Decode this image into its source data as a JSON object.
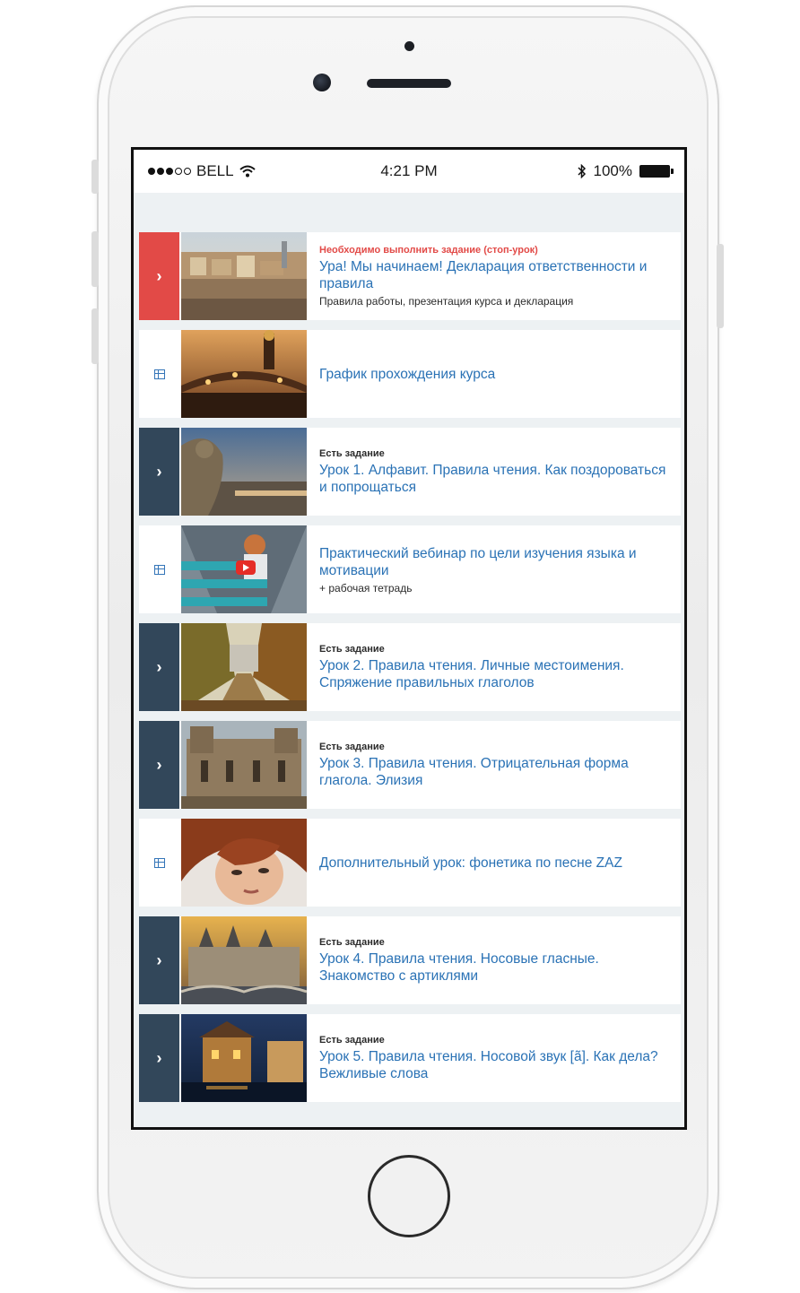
{
  "status_bar": {
    "carrier": "BELL",
    "time": "4:21 PM",
    "battery": "100%",
    "signal_bars": 3,
    "signal_total": 5
  },
  "items": [
    {
      "type": "stop",
      "icon": "chevron-right",
      "tag": "Необходимо выполнить задание (стоп-урок)",
      "title": "Ура! Мы начинаем! Декларация ответственности и правила",
      "subtitle": "Правила работы, презентация курса и декларация",
      "thumb": "paris-rooftops"
    },
    {
      "type": "doc",
      "icon": "table-icon",
      "tag": "",
      "title": "График прохождения курса",
      "subtitle": "",
      "thumb": "bridge-sunset"
    },
    {
      "type": "lesson",
      "icon": "chevron-right",
      "tag": "Есть задание",
      "title": "Урок 1. Алфавит. Правила чтения. Как поздороваться и попрощаться",
      "subtitle": "",
      "thumb": "gargoyle-paris"
    },
    {
      "type": "doc",
      "icon": "table-icon",
      "tag": "",
      "title": "Практический вебинар по цели изучения языка и мотивации",
      "subtitle": "+ рабочая тетрадь",
      "thumb": "webinar-video"
    },
    {
      "type": "lesson",
      "icon": "chevron-right",
      "tag": "Есть задание",
      "title": "Урок 2. Правила чтения. Личные местоимения. Спряжение правильных глаголов",
      "subtitle": "",
      "thumb": "autumn-alley"
    },
    {
      "type": "lesson",
      "icon": "chevron-right",
      "tag": "Есть задание",
      "title": "Урок 3. Правила чтения. Отрицательная форма глагола. Элизия",
      "subtitle": "",
      "thumb": "castle"
    },
    {
      "type": "doc",
      "icon": "table-icon",
      "tag": "",
      "title": "Дополнительный урок: фонетика по песне ZAZ",
      "subtitle": "",
      "thumb": "portrait"
    },
    {
      "type": "lesson",
      "icon": "chevron-right",
      "tag": "Есть задание",
      "title": "Урок 4. Правила чтения. Носовые гласные. Знакомство с артиклями",
      "subtitle": "",
      "thumb": "conciergerie"
    },
    {
      "type": "lesson",
      "icon": "chevron-right",
      "tag": "Есть задание",
      "title": "Урок 5. Правила чтения. Носовой звук [ã]. Как дела? Вежливые слова",
      "subtitle": "",
      "thumb": "annecy-night"
    }
  ],
  "colors": {
    "accent_blue": "#2a72b5",
    "lesson_bar": "#32475a",
    "stop_red": "#e24a47",
    "screen_bg": "#edf1f3"
  }
}
